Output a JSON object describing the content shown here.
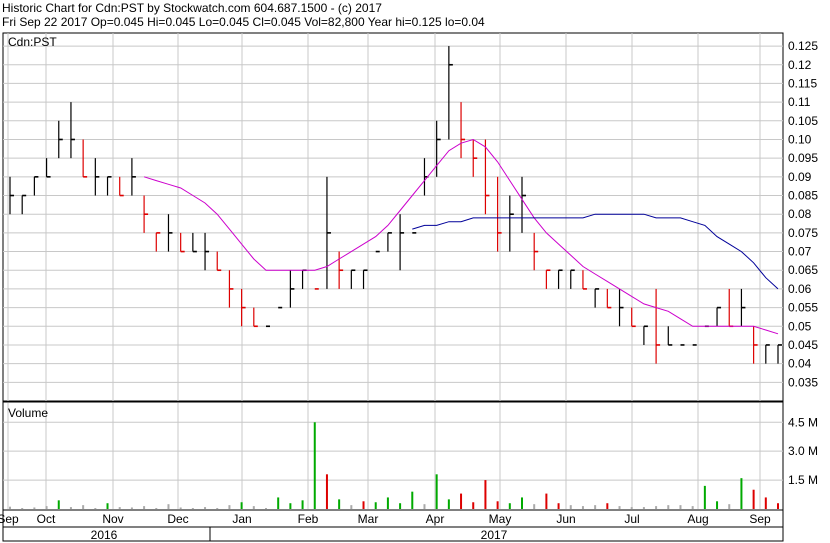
{
  "header": {
    "line1": "Historic Chart for Cdn:PST by Stockwatch.com 604.687.1500 - (c) 2017",
    "line2": "Fri Sep 22 2017  Op=0.045  Hi=0.045  Lo=0.045  Cl=0.045  Vol=82,800  Year hi=0.125  lo=0.04"
  },
  "chart_data": [
    {
      "type": "ohlc",
      "title": "Cdn:PST",
      "ylim": [
        0.03,
        0.1285
      ],
      "y_ticks": [
        "0.035",
        "0.04",
        "0.045",
        "0.05",
        "0.055",
        "0.06",
        "0.065",
        "0.07",
        "0.075",
        "0.08",
        "0.085",
        "0.09",
        "0.095",
        "0.10",
        "0.105",
        "0.11",
        "0.115",
        "0.12",
        "0.125"
      ],
      "grid": true,
      "x_month_labels": [
        "Sep",
        "Oct",
        "Nov",
        "Dec",
        "Jan",
        "Feb",
        "Mar",
        "Apr",
        "May",
        "Jun",
        "Jul",
        "Aug",
        "Sep"
      ],
      "x_year_labels": [
        "2016",
        "2017"
      ],
      "colors": {
        "up": "#000000",
        "down": "#dd0000",
        "ma_short": "#cc00cc",
        "ma_long": "#000099",
        "grid": "#c8c8c8"
      },
      "series": [
        {
          "type": "ohlc",
          "highs": [
            0.09,
            0.085,
            0.09,
            0.095,
            0.105,
            0.11,
            0.1,
            0.095,
            0.09,
            0.09,
            0.095,
            0.085,
            0.075,
            0.08,
            0.075,
            0.075,
            0.075,
            0.07,
            0.065,
            0.06,
            0.055,
            0.05,
            0.055,
            0.065,
            0.065,
            0.06,
            0.09,
            0.07,
            0.065,
            0.065,
            0.065,
            0.075,
            0.08,
            0.075,
            0.095,
            0.105,
            0.125,
            0.11,
            0.1,
            0.1,
            0.09,
            0.085,
            0.09,
            0.075,
            0.065,
            0.065,
            0.065,
            0.065,
            0.06,
            0.06,
            0.06,
            0.055,
            0.05,
            0.06,
            0.05,
            0.045,
            0.045,
            0.05,
            0.055,
            0.06,
            0.06,
            0.05,
            0.045,
            0.045
          ],
          "lows": [
            0.08,
            0.08,
            0.085,
            0.09,
            0.095,
            0.095,
            0.09,
            0.085,
            0.085,
            0.085,
            0.085,
            0.075,
            0.07,
            0.07,
            0.07,
            0.07,
            0.065,
            0.065,
            0.055,
            0.05,
            0.05,
            0.05,
            0.055,
            0.055,
            0.06,
            0.06,
            0.06,
            0.06,
            0.06,
            0.06,
            0.065,
            0.07,
            0.065,
            0.075,
            0.085,
            0.09,
            0.1,
            0.095,
            0.09,
            0.08,
            0.07,
            0.07,
            0.075,
            0.065,
            0.06,
            0.06,
            0.06,
            0.06,
            0.055,
            0.055,
            0.05,
            0.05,
            0.045,
            0.04,
            0.045,
            0.045,
            0.045,
            0.05,
            0.05,
            0.05,
            0.05,
            0.04,
            0.04,
            0.04
          ],
          "closes": [
            0.085,
            0.085,
            0.09,
            0.09,
            0.1,
            0.1,
            0.09,
            0.09,
            0.09,
            0.085,
            0.09,
            0.08,
            0.075,
            0.075,
            0.07,
            0.07,
            0.07,
            0.065,
            0.06,
            0.055,
            0.05,
            0.05,
            0.055,
            0.06,
            0.065,
            0.06,
            0.075,
            0.065,
            0.065,
            0.065,
            0.07,
            0.075,
            0.075,
            0.075,
            0.09,
            0.1,
            0.12,
            0.1,
            0.095,
            0.085,
            0.075,
            0.08,
            0.085,
            0.07,
            0.065,
            0.065,
            0.065,
            0.06,
            0.06,
            0.055,
            0.055,
            0.05,
            0.05,
            0.045,
            0.045,
            0.045,
            0.045,
            0.05,
            0.055,
            0.05,
            0.055,
            0.045,
            0.045,
            0.045
          ]
        },
        {
          "type": "line",
          "values": [
            null,
            null,
            null,
            null,
            null,
            null,
            null,
            null,
            null,
            null,
            null,
            0.09,
            0.089,
            0.088,
            0.087,
            0.085,
            0.083,
            0.08,
            0.076,
            0.072,
            0.068,
            0.065,
            0.065,
            0.065,
            0.065,
            0.065,
            0.066,
            0.068,
            0.07,
            0.072,
            0.074,
            0.077,
            0.081,
            0.085,
            0.089,
            0.093,
            0.097,
            0.099,
            0.1,
            0.098,
            0.094,
            0.089,
            0.084,
            0.079,
            0.075,
            0.072,
            0.069,
            0.066,
            0.064,
            0.062,
            0.06,
            0.058,
            0.056,
            0.055,
            0.054,
            0.052,
            0.05,
            0.05,
            0.05,
            0.05,
            0.05,
            0.05,
            0.049,
            0.048
          ]
        },
        {
          "type": "line",
          "values": [
            null,
            null,
            null,
            null,
            null,
            null,
            null,
            null,
            null,
            null,
            null,
            null,
            null,
            null,
            null,
            null,
            null,
            null,
            null,
            null,
            null,
            null,
            null,
            null,
            null,
            null,
            null,
            null,
            null,
            null,
            null,
            null,
            null,
            0.076,
            0.077,
            0.077,
            0.078,
            0.078,
            0.079,
            0.079,
            0.079,
            0.079,
            0.079,
            0.079,
            0.079,
            0.079,
            0.079,
            0.079,
            0.08,
            0.08,
            0.08,
            0.08,
            0.08,
            0.079,
            0.079,
            0.079,
            0.078,
            0.077,
            0.074,
            0.072,
            0.07,
            0.067,
            0.063,
            0.06
          ]
        }
      ]
    },
    {
      "type": "bar",
      "title": "Volume",
      "y_ticks": [
        "1.5 M",
        "3.0 M",
        "4.5 M"
      ],
      "ylim": [
        0,
        5.5
      ],
      "values": [
        0.12,
        0.05,
        0.08,
        0.15,
        0.45,
        0.1,
        0.2,
        0.05,
        0.3,
        0.1,
        0.08,
        0.15,
        0.05,
        0.25,
        0.08,
        0.05,
        0.1,
        0.05,
        0.2,
        0.35,
        0.15,
        0.05,
        0.6,
        0.3,
        0.45,
        4.5,
        1.8,
        0.5,
        0.2,
        0.4,
        0.35,
        0.6,
        0.3,
        0.9,
        0.25,
        1.8,
        0.5,
        0.8,
        0.35,
        1.5,
        0.4,
        0.3,
        0.6,
        0.25,
        0.8,
        0.3,
        0.2,
        0.15,
        0.2,
        0.3,
        0.15,
        0.1,
        0.1,
        0.15,
        0.2,
        0.2,
        0.15,
        1.2,
        0.4,
        0.25,
        1.6,
        1.0,
        0.6,
        0.3
      ],
      "up": [
        false,
        false,
        true,
        true,
        true,
        true,
        true,
        false,
        true,
        false,
        true,
        true,
        false,
        true,
        false,
        false,
        true,
        false,
        true,
        true,
        true,
        false,
        true,
        true,
        true,
        true,
        false,
        true,
        false,
        false,
        true,
        true,
        true,
        true,
        true,
        true,
        true,
        false,
        false,
        false,
        false,
        true,
        true,
        false,
        false,
        false,
        false,
        false,
        false,
        false,
        false,
        false,
        false,
        false,
        false,
        false,
        false,
        true,
        true,
        true,
        true,
        false,
        false,
        false
      ],
      "colors": {
        "up": "#00aa00",
        "down": "#dd0000",
        "neutral": "#aaaaaa"
      }
    }
  ]
}
